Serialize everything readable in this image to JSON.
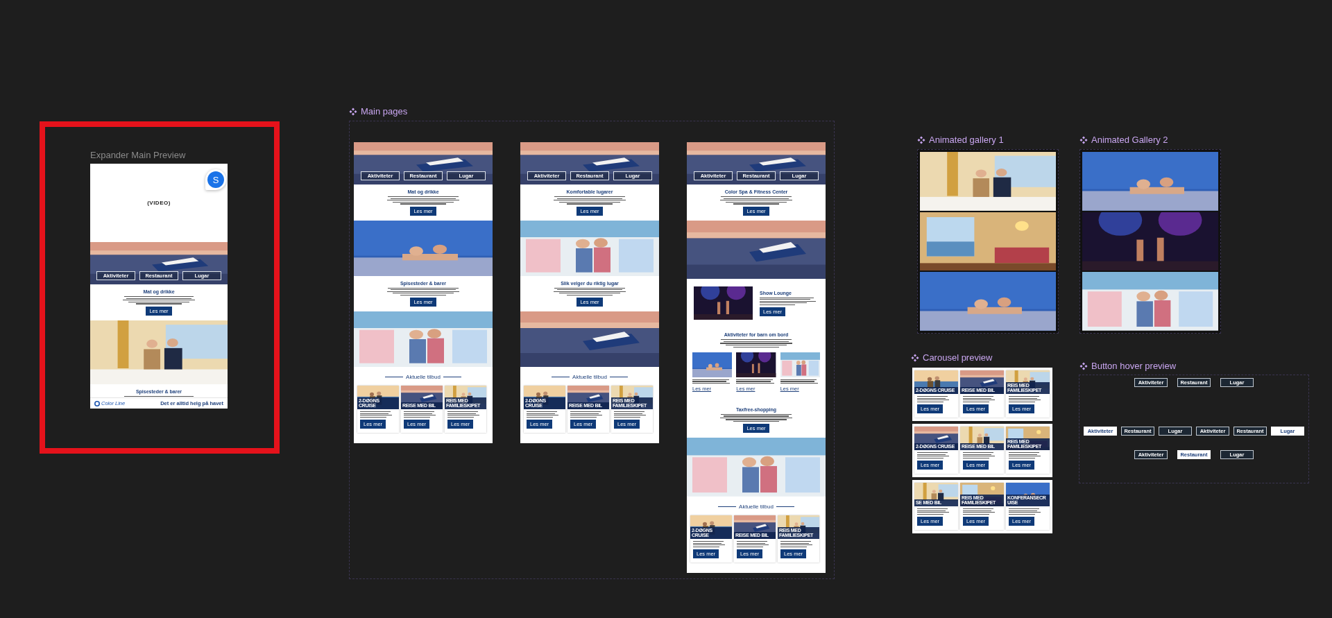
{
  "expander": {
    "title": "Expander Main Preview",
    "video_label": "(VIDEO)",
    "avatar": "S",
    "sections": [
      {
        "kind": "hero",
        "nav": [
          "Aktiviteter",
          "Restaurant",
          "Lugar"
        ]
      },
      {
        "kind": "text",
        "heading": "Mat og drikke",
        "button": "Les mer"
      },
      {
        "kind": "picture"
      },
      {
        "kind": "text",
        "heading": "Spisesteder & barer"
      }
    ],
    "footer": {
      "logo": "Color Line",
      "slogan": "Det er alltid helg på havet"
    }
  },
  "main_pages": {
    "title": "Main pages",
    "pages": [
      {
        "sections": [
          {
            "kind": "hero",
            "nav": [
              "Aktiviteter",
              "Restaurant",
              "Lugar"
            ]
          },
          {
            "kind": "text",
            "heading": "Mat og drikke",
            "button": "Les mer"
          },
          {
            "kind": "picture"
          },
          {
            "kind": "text",
            "heading": "Spisesteder & barer",
            "button": "Les mer"
          },
          {
            "kind": "picture"
          },
          {
            "kind": "offers",
            "heading": "Aktuelle tilbud",
            "cards": [
              {
                "title": "2-DØGNS CRUISE",
                "button": "Les mer"
              },
              {
                "title": "REISE MED BIL",
                "button": "Les mer"
              },
              {
                "title": "REIS MED FAMILIESKIPET",
                "button": "Les mer"
              }
            ]
          }
        ]
      },
      {
        "sections": [
          {
            "kind": "hero",
            "nav": [
              "Aktiviteter",
              "Restaurant",
              "Lugar"
            ]
          },
          {
            "kind": "text",
            "heading": "Komfortable lugarer",
            "button": "Les mer"
          },
          {
            "kind": "picture"
          },
          {
            "kind": "text",
            "heading": "Slik velger du riktig lugar",
            "button": "Les mer"
          },
          {
            "kind": "picture"
          },
          {
            "kind": "offers",
            "heading": "Aktuelle tilbud",
            "cards": [
              {
                "title": "2-DØGNS CRUISE",
                "button": "Les mer"
              },
              {
                "title": "REISE MED BIL",
                "button": "Les mer"
              },
              {
                "title": "REIS MED FAMILIESKIPET",
                "button": "Les mer"
              }
            ]
          }
        ]
      },
      {
        "sections": [
          {
            "kind": "hero",
            "nav": [
              "Aktiviteter",
              "Restaurant",
              "Lugar"
            ]
          },
          {
            "kind": "text",
            "heading": "Color Spa & Fitness Center",
            "button": "Les mer"
          },
          {
            "kind": "picture"
          },
          {
            "kind": "media",
            "heading": "Show Lounge",
            "button": "Les mer"
          },
          {
            "kind": "text",
            "heading": "Aktiviteter for barn om bord"
          },
          {
            "kind": "tiles",
            "tiles": [
              {
                "link": "Les mer"
              },
              {
                "link": "Les mer"
              },
              {
                "link": "Les mer"
              }
            ]
          },
          {
            "kind": "text",
            "heading": "Taxfree-shopping",
            "button": "Les mer"
          },
          {
            "kind": "picture"
          },
          {
            "kind": "offers",
            "heading": "Aktuelle tilbud",
            "cards": [
              {
                "title": "2-DØGNS CRUISE",
                "button": "Les mer"
              },
              {
                "title": "REISE MED BIL",
                "button": "Les mer"
              },
              {
                "title": "REIS MED FAMILIESKIPET",
                "button": "Les mer"
              }
            ]
          }
        ]
      }
    ]
  },
  "galleries": [
    {
      "title": "Animated gallery 1",
      "pictures": [
        {
          "kind": "picture"
        },
        {
          "kind": "picture"
        },
        {
          "kind": "picture"
        }
      ]
    },
    {
      "title": "Animated Gallery 2",
      "pictures": [
        {
          "kind": "picture"
        },
        {
          "kind": "picture"
        },
        {
          "kind": "picture"
        }
      ]
    }
  ],
  "carousel": {
    "title": "Carousel preview",
    "rows": [
      {
        "cards": [
          {
            "title": "2-DØGNS CRUISE",
            "button": "Les mer"
          },
          {
            "title": "REISE MED BIL",
            "button": "Les mer"
          },
          {
            "title": "REIS MED FAMILIESKIPET",
            "button": "Les mer"
          }
        ]
      },
      {
        "cards": [
          {
            "title": "2-DØGNS CRUISE",
            "button": "Les mer"
          },
          {
            "title": "REISE MED BIL",
            "button": "Les mer"
          },
          {
            "title": "REIS MED FAMILIESKIPET",
            "button": "Les mer"
          }
        ]
      },
      {
        "cards": [
          {
            "title": "SE MED BIL",
            "button": "Les mer"
          },
          {
            "title": "REIS MED FAMILIESKIPET",
            "button": "Les mer"
          },
          {
            "title": "KONFERANSECRUISE",
            "button": "Les mer"
          }
        ]
      }
    ]
  },
  "button_hover": {
    "title": "Button hover preview",
    "rows": [
      [
        {
          "label": "Aktiviteter",
          "hovered": false
        },
        {
          "label": "Restaurant",
          "hovered": false
        },
        {
          "label": "Lugar",
          "hovered": false
        }
      ],
      [
        {
          "label": "Aktiviteter",
          "hovered": true
        },
        {
          "label": "Restaurant",
          "hovered": false
        },
        {
          "label": "Lugar",
          "hovered": false
        },
        {
          "label": "Aktiviteter",
          "hovered": false
        },
        {
          "label": "Restaurant",
          "hovered": false
        },
        {
          "label": "Lugar",
          "hovered": true
        }
      ],
      [
        {
          "label": "Aktiviteter",
          "hovered": false
        },
        {
          "label": "Restaurant",
          "hovered": true
        },
        {
          "label": "Lugar",
          "hovered": false
        }
      ]
    ]
  }
}
